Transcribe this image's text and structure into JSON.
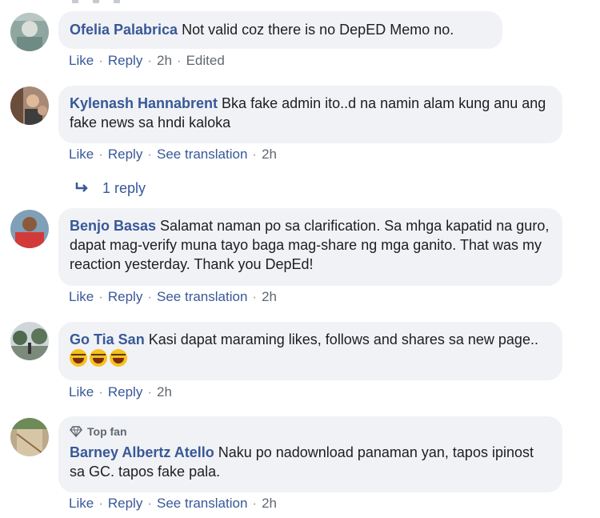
{
  "comments": [
    {
      "author": "Ofelia Palabrica",
      "text": "Not valid coz there is no DepED Memo no.",
      "actions": {
        "like": "Like",
        "reply": "Reply",
        "time": "2h",
        "edited": "Edited"
      },
      "avatar": "avatar-ofelia"
    },
    {
      "author": "Kylenash Hannabrent",
      "text": "Bka fake admin ito..d na namin alam kung anu ang fake news sa hndi kaloka",
      "actions": {
        "like": "Like",
        "reply": "Reply",
        "translate": "See translation",
        "time": "2h"
      },
      "replies_label": "1 reply",
      "avatar": "avatar-kylenash"
    },
    {
      "author": "Benjo Basas",
      "text": "Salamat naman po sa clarification. Sa mhga kapatid na guro, dapat mag-verify muna tayo baga mag-share ng mga ganito. That was my reaction yesterday. Thank you DepEd!",
      "actions": {
        "like": "Like",
        "reply": "Reply",
        "translate": "See translation",
        "time": "2h"
      },
      "avatar": "avatar-benjo"
    },
    {
      "author": "Go Tia San",
      "text": "Kasi dapat maraming likes, follows and shares sa new page..",
      "emoji_count": 3,
      "emoji_icon": "laughing-tears-emoji",
      "actions": {
        "like": "Like",
        "reply": "Reply",
        "time": "2h"
      },
      "avatar": "avatar-go-tia-san"
    },
    {
      "author": "Barney Albertz Atello",
      "badge": "Top fan",
      "text": "Naku po nadownload panaman yan, tapos ipinost sa GC. tapos fake pala.",
      "actions": {
        "like": "Like",
        "reply": "Reply",
        "translate": "See translation",
        "time": "2h"
      },
      "avatar": "avatar-barney"
    }
  ],
  "colors": {
    "author": "#385898",
    "bubble": "#f0f2f5",
    "meta": "#606770",
    "text": "#1c1e21"
  },
  "icons": {
    "reply_arrow": "reply-arrow-icon",
    "top_fan": "diamond-icon"
  }
}
